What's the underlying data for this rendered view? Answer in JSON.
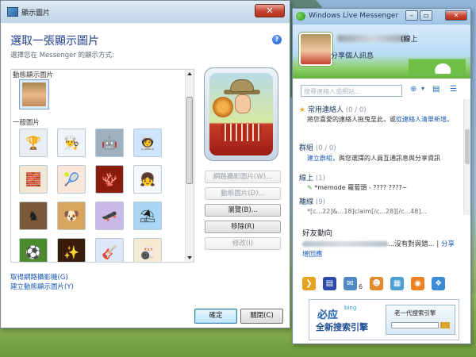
{
  "dialog": {
    "title": "顯示圖片",
    "close_glyph": "✕",
    "heading": "選取一張顯示圖片",
    "subtitle": "選擇您在 Messenger 的顯示方式:",
    "animated_label": "動態顯示圖片",
    "general_label": "一般圖片",
    "buttons": {
      "webcam": "網路攝影圖片(W)...",
      "animated": "動態圖片(D)...",
      "browse": "瀏覽(B)...",
      "remove": "移除(R)",
      "modify": "修改(I)",
      "ok": "確定",
      "close": "關閉(C)"
    },
    "links": {
      "get_webcam": "取得網路攝影機(G)",
      "create_animated": "建立動態顯示圖片(Y)"
    },
    "thumbnails": [
      {
        "icon": "trophy-person-icon",
        "glyph": "🏆",
        "bg": "#e9eef5"
      },
      {
        "icon": "chef-icon",
        "glyph": "👨‍🍳",
        "bg": "#eef3fa"
      },
      {
        "icon": "robot-icon",
        "glyph": "🤖",
        "bg": "#9fb0c0"
      },
      {
        "icon": "astronaut-icon",
        "glyph": "🧑‍🚀",
        "bg": "#cfe5ff"
      },
      {
        "icon": "blocks-icon",
        "glyph": "🧱",
        "bg": "#f2e6d4"
      },
      {
        "icon": "tennis-player-icon",
        "glyph": "🎾",
        "bg": "#fbe6dc"
      },
      {
        "icon": "coral-icon",
        "glyph": "🪸",
        "bg": "#8a1c0e"
      },
      {
        "icon": "girl-icon",
        "glyph": "👧",
        "bg": "#f5f7fb"
      },
      {
        "icon": "chess-icon",
        "glyph": "♞",
        "bg": "#7a5a3a"
      },
      {
        "icon": "dog-icon",
        "glyph": "🐶",
        "bg": "#d8a55c"
      },
      {
        "icon": "skater-icon",
        "glyph": "🛹",
        "bg": "#c9b8e8"
      },
      {
        "icon": "beach-umbrella-icon",
        "glyph": "⛱",
        "bg": "#a9d6f2"
      },
      {
        "icon": "soccer-ball-icon",
        "glyph": "⚽",
        "bg": "#4c8a2e"
      },
      {
        "icon": "sparkle-icon",
        "glyph": "✨",
        "bg": "#3a1c0c"
      },
      {
        "icon": "guitar-player-icon",
        "glyph": "🎸",
        "bg": "#dce8f6"
      },
      {
        "icon": "bowling-icon",
        "glyph": "🎳",
        "bg": "#f5ead2"
      }
    ]
  },
  "messenger": {
    "title": "Windows Live Messenger",
    "online_status": "(線上",
    "share_message": "分享個人訊息",
    "search_placeholder": "搜尋連絡人或網站...",
    "groups": {
      "favorites": {
        "label": "常用連絡人",
        "count": "(0 / 0)"
      },
      "favorites_note": "將您喜愛的連絡人拖曳至此，或",
      "favorites_link": "從連絡人清單新增",
      "favorites_note_end": "。",
      "groups": {
        "label": "群組",
        "count": "(0 / 0)"
      },
      "groups_link": "建立群組",
      "groups_note": "，與您選擇的人員互通訊息與分享資訊",
      "online": {
        "label": "線上",
        "count": "(1)"
      },
      "online_contact": "*memode 蘿蔔頭 - ???? ????~",
      "offline": {
        "label": "離線",
        "count": "(9)"
      },
      "offline_contact": "*[c...22]&...18]claim[/c...28][/c...48]..."
    },
    "news": {
      "title": "好友動向",
      "text": "...沒有對與錯...",
      "link1": "分享",
      "link2": "增回應"
    },
    "bottom_icons": [
      {
        "icon": "windows-live-icon",
        "glyph": "❯",
        "color": "#e7a31f"
      },
      {
        "icon": "flag-icon",
        "glyph": "▤",
        "color": "#2d4aa8"
      },
      {
        "icon": "mail-icon",
        "glyph": "✉",
        "color": "#4e88c5"
      },
      {
        "icon": "contacts-icon",
        "glyph": "☻",
        "color": "#e28a2e"
      },
      {
        "icon": "photos-icon",
        "glyph": "▦",
        "color": "#4e9fd1"
      },
      {
        "icon": "rss-icon",
        "glyph": "◉",
        "color": "#ec7f1f"
      },
      {
        "icon": "windows-icon",
        "glyph": "❖",
        "color": "#3b8ad6"
      }
    ],
    "mail_count": "6",
    "ad": {
      "brand": "必应",
      "brand_sub": "bing",
      "slogan": "全新搜索引擎",
      "box_title": "老一代搜索引擎"
    }
  }
}
